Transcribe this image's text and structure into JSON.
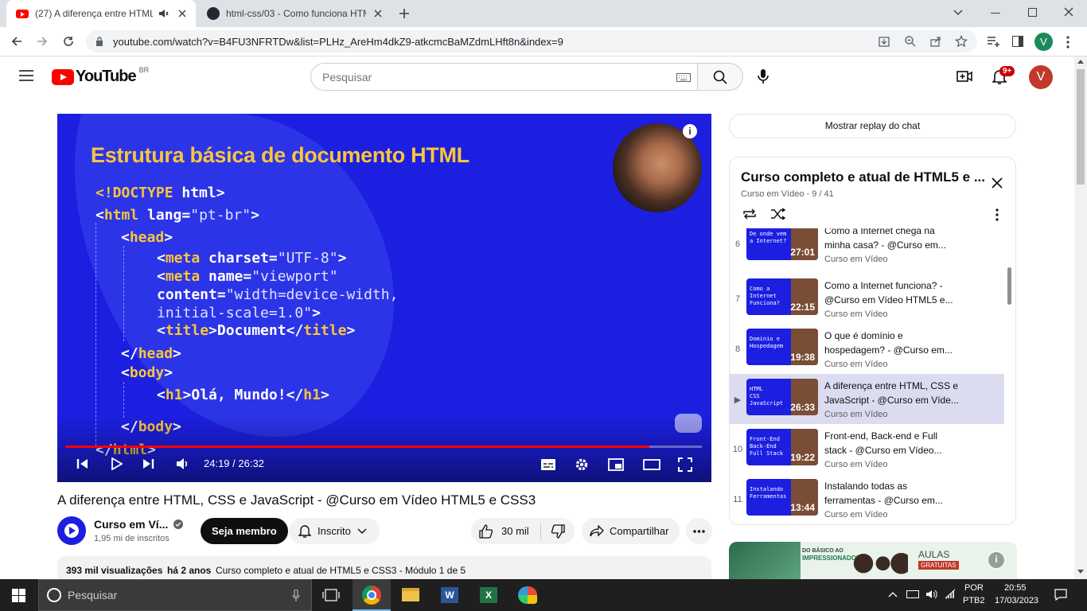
{
  "browser": {
    "tabs": [
      {
        "title": "(27) A diferença entre HTML",
        "active": true
      },
      {
        "title": "html-css/03 - Como funciona HTML",
        "active": false
      }
    ],
    "url": "youtube.com/watch?v=B4FU3NFRTDw&list=PLHz_AreHm4dkZ9-atkcmcBaMZdmLHft8n&index=9",
    "profile_initial": "V"
  },
  "youtube": {
    "logo_text": "YouTube",
    "region": "BR",
    "search_placeholder": "Pesquisar",
    "notifications_badge": "9+",
    "avatar_initial": "V"
  },
  "player": {
    "slide_title": "Estrutura básica de documento HTML",
    "code_lines": [
      "<!DOCTYPE html>",
      "<html lang=\"pt-br\">",
      "<head>",
      "<meta charset=\"UTF-8\">",
      "<meta name=\"viewport\"",
      "content=\"width=device-width,",
      "initial-scale=1.0\">",
      "<title>Document</title>",
      "</head>",
      "<body>",
      "<h1>Olá, Mundo!</h1>",
      "</body>",
      "</html>"
    ],
    "time": "24:19 / 26:32",
    "progress": 0.917
  },
  "video": {
    "title": "A diferença entre HTML, CSS e JavaScript - @Curso em Vídeo HTML5 e CSS3",
    "channel": "Curso em Ví...",
    "subscribers": "1,95 mi de inscritos",
    "member_btn": "Seja membro",
    "subscribed_btn": "Inscrito",
    "likes": "30 mil",
    "share_btn": "Compartilhar",
    "views": "393 mil visualizações",
    "age": "há 2 anos",
    "description_start": "Curso completo e atual de HTML5 e CSS3 - Módulo 1 de 5"
  },
  "sidebar": {
    "chat_replay": "Mostrar replay do chat",
    "playlist_title": "Curso completo e atual de HTML5 e ...",
    "playlist_sub": "Curso em Vídeo - 9 / 41",
    "items": [
      {
        "num": "6",
        "title": "Como a Internet chega na minha casa? - @Curso em...",
        "channel": "Curso em Vídeo",
        "duration": "27:01",
        "thumb": "De onde vem\na Internet?",
        "current": false
      },
      {
        "num": "7",
        "title": "Como a Internet funciona? - @Curso em Vídeo HTML5 e...",
        "channel": "Curso em Vídeo",
        "duration": "22:15",
        "thumb": "Como a\nInternet\nFunciona?",
        "current": false
      },
      {
        "num": "8",
        "title": "O que é domínio e hospedagem? - @Curso em...",
        "channel": "Curso em Vídeo",
        "duration": "19:38",
        "thumb": "Domínio e\nHospedagem",
        "current": false
      },
      {
        "num": "▶",
        "title": "A diferença entre HTML, CSS e JavaScript - @Curso em Víde...",
        "channel": "Curso em Vídeo",
        "duration": "26:33",
        "thumb": "HTML\nCSS\nJavaScript",
        "current": true
      },
      {
        "num": "10",
        "title": "Front-end, Back-end e Full stack - @Curso em Vídeo...",
        "channel": "Curso em Vídeo",
        "duration": "19:22",
        "thumb": "Front-End\nBack-End\nFull Stack",
        "current": false
      },
      {
        "num": "11",
        "title": "Instalando todas as ferramentas - @Curso em...",
        "channel": "Curso em Vídeo",
        "duration": "13:44",
        "thumb": "Instalando\nFerramentas",
        "current": false
      }
    ],
    "ad": {
      "line1": "DO BÁSICO AO",
      "line2": "IMPRESSIONADOR",
      "badge1": "AULAS",
      "badge2": "GRATUITAS"
    }
  },
  "taskbar": {
    "search_placeholder": "Pesquisar",
    "lang1": "POR",
    "lang2": "PTB2",
    "time": "20:55",
    "date": "17/03/2023"
  }
}
